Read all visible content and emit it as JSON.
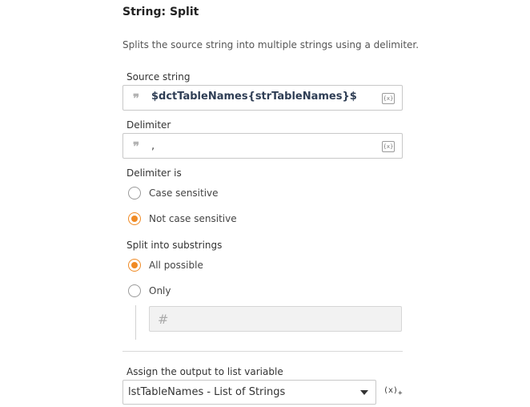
{
  "header": {
    "title": "String: Split",
    "description": "Splits the source string into multiple strings using a delimiter."
  },
  "source_string": {
    "label": "Source string",
    "value": "$dctTableNames{strTableNames}$",
    "quote_icon": "quote-icon",
    "var_icon": "variable-icon",
    "var_icon_text": "{x}"
  },
  "delimiter": {
    "label": "Delimiter",
    "value": ",",
    "quote_icon": "quote-icon",
    "var_icon": "variable-icon",
    "var_icon_text": "{x}"
  },
  "delimiter_is": {
    "label": "Delimiter is",
    "options": [
      {
        "label": "Case sensitive",
        "selected": false
      },
      {
        "label": "Not case sensitive",
        "selected": true
      }
    ]
  },
  "split_into": {
    "label": "Split into substrings",
    "options": [
      {
        "label": "All possible",
        "selected": true
      },
      {
        "label": "Only",
        "selected": false
      }
    ],
    "number_placeholder_icon": "hash-icon",
    "number_icon_text": "#"
  },
  "output": {
    "label": "Assign the output to list variable",
    "selected_value": "lstTableNames - List of Strings",
    "add_variable_text": "(x)",
    "add_variable_plus": "+"
  },
  "colors": {
    "accent": "#f08a24",
    "border": "#c8c8c8",
    "variable_text": "#2f3e55"
  },
  "quote_glyph": "❞"
}
